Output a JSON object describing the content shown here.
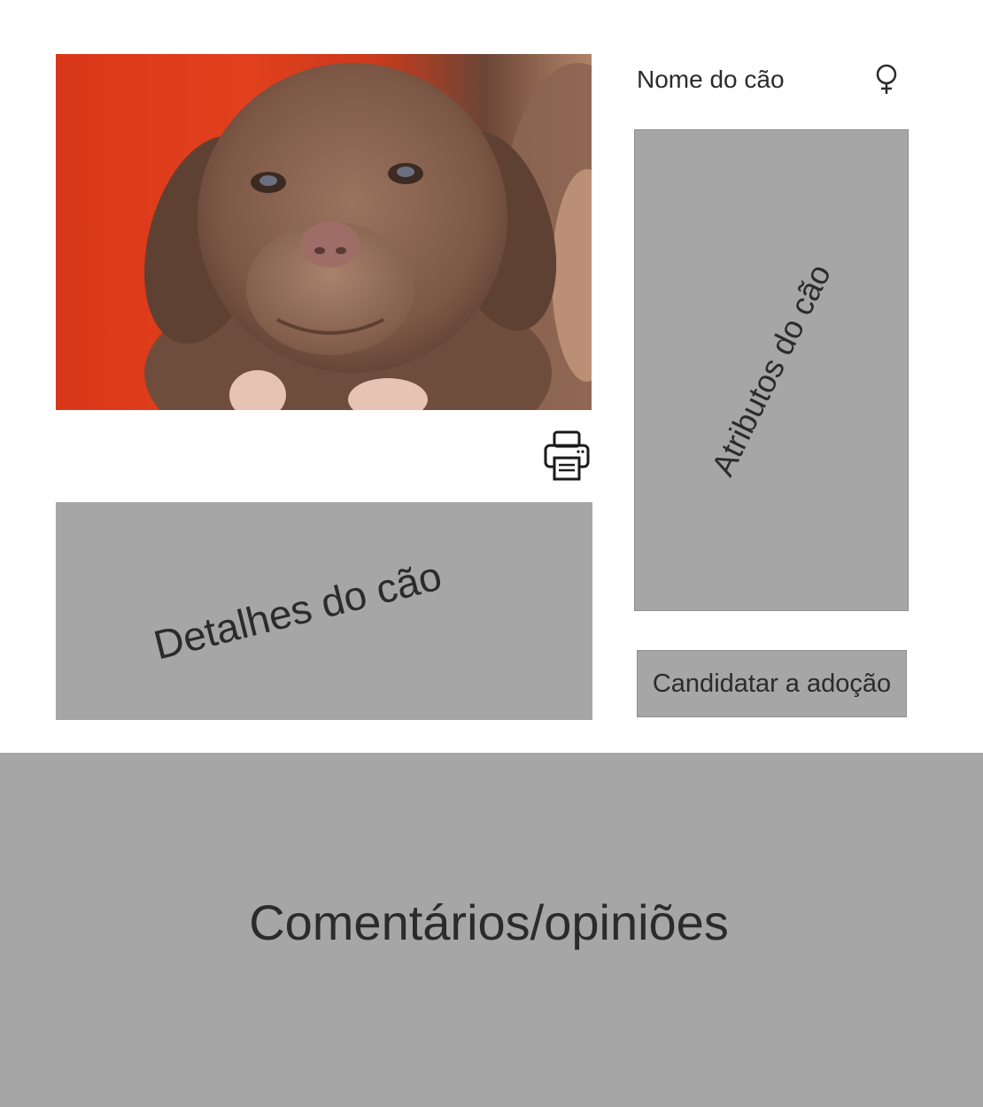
{
  "header": {
    "dog_name": "Nome do cão",
    "gender_icon": "female-symbol-icon"
  },
  "photo": {
    "subject": "chocolate-labrador-puppy-photo"
  },
  "attributes": {
    "label": "Atributos do cão"
  },
  "details": {
    "label": "Detalhes do cão"
  },
  "actions": {
    "print_icon": "printer-icon",
    "adopt_label": "Candidatar a adoção"
  },
  "comments": {
    "label": "Comentários/opiniões"
  },
  "colors": {
    "placeholder_gray": "#a6a6a6",
    "border_gray": "#8f8f8f",
    "text": "#2b2b2b",
    "photo_background": "#e2401c"
  }
}
